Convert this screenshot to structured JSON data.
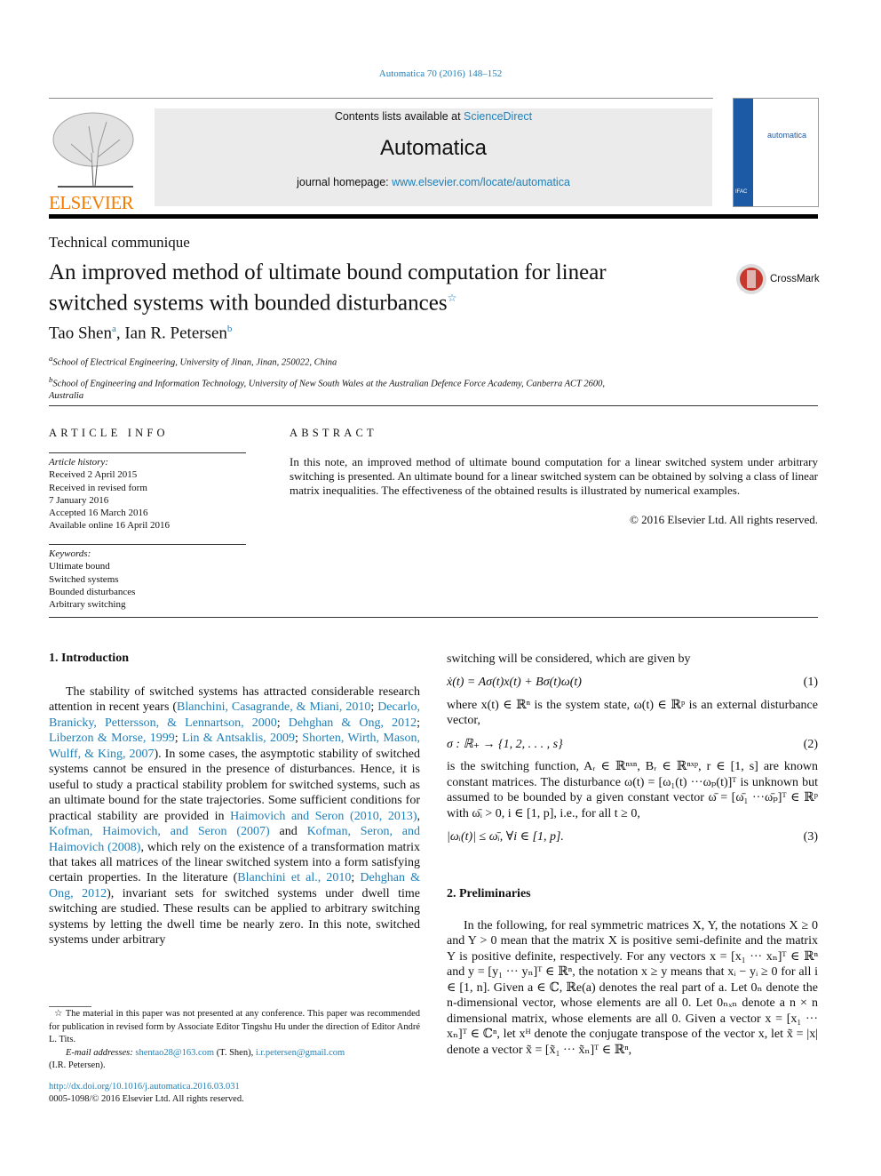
{
  "header": {
    "citation": "Automatica 70 (2016) 148–152",
    "contents_prefix": "Contents lists available at ",
    "contents_link": "ScienceDirect",
    "journal": "Automatica",
    "homepage_prefix": "journal homepage: ",
    "homepage_link": "www.elsevier.com/locate/automatica",
    "publisher": "ELSEVIER",
    "cover_title": "automatica",
    "cover_badge": "IFAC"
  },
  "colors": {
    "link": "#1f7fb8",
    "elsevier_orange": "#f07c00",
    "cover_blue": "#1d5aa6"
  },
  "article": {
    "type": "Technical communique",
    "title_line1": "An improved method of ultimate bound computation for linear",
    "title_line2": "switched systems with bounded disturbances",
    "title_star": "☆",
    "crossmark": "CrossMark",
    "authors": [
      {
        "name": "Tao Shen",
        "sup": "a"
      },
      {
        "name": "Ian R. Petersen",
        "sup": "b"
      }
    ],
    "affiliations": [
      {
        "sup": "a",
        "text": "School of Electrical Engineering, University of Jinan, Jinan, 250022, China"
      },
      {
        "sup": "b",
        "text": "School of Engineering and Information Technology, University of New South Wales at the Australian Defence Force Academy, Canberra ACT 2600,"
      },
      {
        "sup": "",
        "text": "Australia"
      }
    ]
  },
  "info": {
    "heading": "ARTICLE INFO",
    "history_label": "Article history:",
    "history": [
      "Received 2 April 2015",
      "Received in revised form",
      "7 January 2016",
      "Accepted 16 March 2016",
      "Available online 16 April 2016"
    ],
    "keywords_label": "Keywords:",
    "keywords": [
      "Ultimate bound",
      "Switched systems",
      "Bounded disturbances",
      "Arbitrary switching"
    ]
  },
  "abstract": {
    "heading": "ABSTRACT",
    "text": "In this note, an improved method of ultimate bound computation for a linear switched system under arbitrary switching is presented. An ultimate bound for a linear switched system can be obtained by solving a class of linear matrix inequalities. The effectiveness of the obtained results is illustrated by numerical examples.",
    "copyright": "© 2016 Elsevier Ltd. All rights reserved."
  },
  "intro": {
    "heading": "1.  Introduction",
    "segments": [
      {
        "t": "The stability of switched systems has attracted considerable research attention in recent years ("
      },
      {
        "t": "Blanchini, Casagrande, & Miani, 2010",
        "l": 1
      },
      {
        "t": "; "
      },
      {
        "t": "Decarlo, Branicky, Pettersson, & Lennartson, 2000",
        "l": 1
      },
      {
        "t": "; "
      },
      {
        "t": "Dehghan & Ong, 2012",
        "l": 1
      },
      {
        "t": "; "
      },
      {
        "t": "Liberzon & Morse, 1999",
        "l": 1
      },
      {
        "t": "; "
      },
      {
        "t": "Lin & Antsaklis, 2009",
        "l": 1
      },
      {
        "t": "; "
      },
      {
        "t": "Shorten, Wirth, Mason, Wulff, & King, 2007",
        "l": 1
      },
      {
        "t": "). In some cases, the asymptotic stability of switched systems cannot be ensured in the presence of disturbances. Hence, it is useful to study a practical stability problem for switched systems, such as an ultimate bound for the state trajectories. Some sufficient conditions for practical stability are provided in "
      },
      {
        "t": "Haimovich and Seron (2010, 2013)",
        "l": 1
      },
      {
        "t": ", "
      },
      {
        "t": "Kofman, Haimovich, and Seron (2007)",
        "l": 1
      },
      {
        "t": " and "
      },
      {
        "t": "Kofman, Seron, and Haimovich (2008)",
        "l": 1
      },
      {
        "t": ", which rely on the existence of a transformation matrix that takes all matrices of the linear switched system into a form satisfying certain properties. In the literature ("
      },
      {
        "t": "Blanchini et al., 2010",
        "l": 1
      },
      {
        "t": "; "
      },
      {
        "t": "Dehghan & Ong, 2012",
        "l": 1
      },
      {
        "t": "), invariant sets for switched systems under dwell time switching are studied. These results can be applied to arbitrary switching systems by letting the dwell time be nearly zero. In this note, switched systems under arbitrary"
      }
    ]
  },
  "footnote": {
    "star": "☆",
    "text": "The material in this paper was not presented at any conference. This paper was recommended for publication in revised form by Associate Editor Tingshu Hu under the direction of Editor André L. Tits.",
    "email_label": "E-mail addresses: ",
    "email1": "shentao28@163.com",
    "name1": " (T. Shen), ",
    "email2": "i.r.petersen@gmail.com",
    "name2": "(I.R. Petersen).",
    "doi": "http://dx.doi.org/10.1016/j.automatica.2016.03.031",
    "issn": "0005-1098/© 2016 Elsevier Ltd. All rights reserved."
  },
  "right": {
    "p1": "switching will be considered, which are given by",
    "eq1": "ẋ(t) = Aσ(t)x(t) + Bσ(t)ω(t)",
    "eq1_num": "(1)",
    "p2": "where x(t) ∈ ℝⁿ is the system state, ω(t) ∈ ℝᵖ is an external disturbance vector,",
    "eq2": "σ : ℝ₊ → {1, 2, . . . , s}",
    "eq2_num": "(2)",
    "p3": "is the switching function, Aᵣ ∈ ℝⁿˣⁿ, Bᵣ ∈ ℝⁿˣᵖ, r ∈ [1, s] are known constant matrices. The disturbance ω(t) = [ω₁(t) ···ωₚ(t)]ᵀ is unknown but assumed to be bounded by a given constant vector ω̄ = [ω̄₁ ···ω̄ₚ]ᵀ ∈ ℝᵖ with ω̄ᵢ > 0, i ∈ [1, p], i.e., for all t ≥ 0,",
    "eq3": "|ωᵢ(t)| ≤ ω̄ᵢ,    ∀i ∈ [1, p].",
    "eq3_num": "(3)",
    "heading2": "2.  Preliminaries",
    "p4": "In the following, for real symmetric matrices X, Y, the notations X ≥ 0 and Y > 0 mean that the matrix X is positive semi-definite and the matrix Y is positive definite, respectively. For any vectors x = [x₁ ··· xₙ]ᵀ ∈ ℝⁿ and y = [y₁ ··· yₙ]ᵀ ∈ ℝⁿ, the notation x ≥ y means that xᵢ − yᵢ ≥ 0 for all i ∈ [1, n]. Given a ∈ ℂ, ℝe(a) denotes the real part of a. Let 0ₙ denote the n-dimensional vector, whose elements are all 0. Let 0ₙₓₙ denote a n × n dimensional matrix, whose elements are all 0. Given a vector x = [x₁ ··· xₙ]ᵀ ∈ ℂⁿ, let xᴴ denote the conjugate transpose of the vector x, let x̃ = |x| denote a vector x̃ = [x̃₁ ··· x̃ₙ]ᵀ ∈ ℝⁿ,"
  }
}
